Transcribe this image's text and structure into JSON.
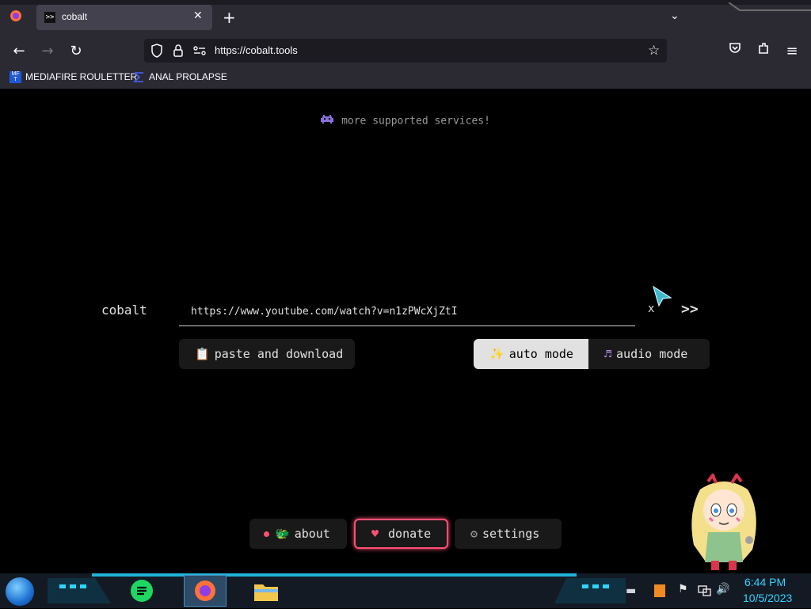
{
  "browser": {
    "tab": {
      "title": "cobalt",
      "favicon": ">>"
    },
    "address": {
      "url": "https://cobalt.tools"
    },
    "bookmarks": [
      {
        "label": "MEDIAFIRE ROULETTER",
        "icon": "mediafire-icon"
      },
      {
        "label": "ANAL PROLAPSE",
        "icon": "sigma-icon"
      }
    ]
  },
  "page": {
    "services_link": "more supported services!",
    "logo": "cobalt",
    "input": {
      "value": "https://www.youtube.com/watch?v=n1zPWcXjZtI"
    },
    "clear_label": "x",
    "go_label": ">>",
    "paste_label": "paste and download",
    "mode": {
      "auto_label": "auto mode",
      "audio_label": "audio mode",
      "selected": "auto"
    },
    "footer": {
      "about_label": "about",
      "donate_label": "donate",
      "settings_label": "settings"
    }
  },
  "taskbar": {
    "time": "6:44 PM",
    "date": "10/5/2023"
  },
  "colors": {
    "accent_donate": "#ff4f75",
    "page_bg": "#000000",
    "clock": "#2fd4ff"
  }
}
